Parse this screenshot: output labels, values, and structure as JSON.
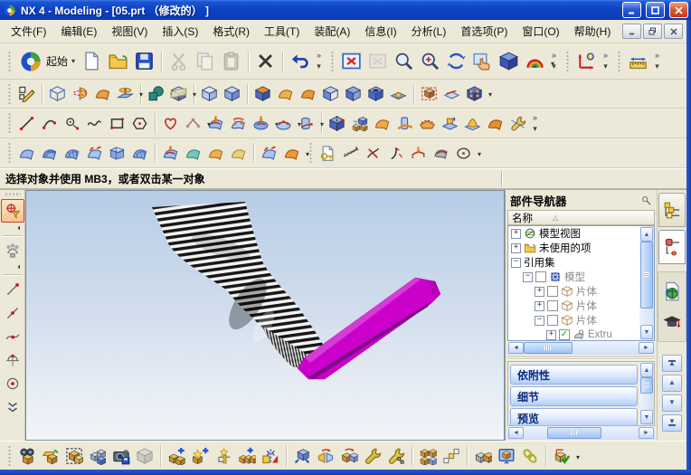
{
  "title": "NX 4 - Modeling - [05.prt （修改的） ]",
  "prompt": "选择对象并使用 MB3，或者双击某一对象",
  "menu_bar": {
    "items": [
      "文件(F)",
      "编辑(E)",
      "视图(V)",
      "插入(S)",
      "格式(R)",
      "工具(T)",
      "装配(A)",
      "信息(I)",
      "分析(L)",
      "首选项(P)",
      "窗口(O)",
      "帮助(H)"
    ]
  },
  "colors": {
    "titlebar_blue": "#0d43c4",
    "toolbar_bg": "#ece9d8",
    "viewport_top": "#b7cde6",
    "viewport_bottom": "#f2f5f9",
    "model_magenta": "#cb00ca",
    "section_text": "#0a2a7a"
  },
  "toolbars": {
    "start_label": "起始",
    "rowa": [
      {
        "n": "new-file-icon",
        "t": "page"
      },
      {
        "n": "open-file-icon",
        "t": "folder"
      },
      {
        "n": "save-icon",
        "t": "floppy"
      },
      {
        "n": "cut-icon",
        "t": "scissors",
        "f": "sD"
      },
      {
        "n": "copy-icon",
        "t": "pages",
        "f": "D"
      },
      {
        "n": "paste-icon",
        "t": "clip",
        "f": "D"
      },
      {
        "n": "delete-icon",
        "t": "xmark",
        "f": "s"
      },
      {
        "n": "undo-icon",
        "t": "undo",
        "f": "s"
      },
      {
        "n": "toolbar-overflow-icon",
        "t": "ovf"
      },
      {
        "n": "fit-view-icon",
        "t": "fitbox",
        "f": "b"
      },
      {
        "n": "zoom-window-icon",
        "t": "winrect",
        "f": "D"
      },
      {
        "n": "zoom-icon",
        "t": "mag"
      },
      {
        "n": "zoom-in-out-icon",
        "t": "magp"
      },
      {
        "n": "rotate-view-icon",
        "t": "rotate"
      },
      {
        "n": "pan-view-icon",
        "t": "hand"
      },
      {
        "n": "shaded-view-icon",
        "t": "cube",
        "c": [
          "#7b9be8",
          "#3a55c0",
          "#28409c"
        ]
      },
      {
        "n": "rendering-style-icon",
        "t": "rainbow",
        "f": "d"
      },
      {
        "n": "toolbar-overflow-icon",
        "t": "ovf"
      },
      {
        "n": "view-triad-icon",
        "t": "axes",
        "f": "b"
      },
      {
        "n": "toolbar-overflow-icon",
        "t": "ovf"
      },
      {
        "n": "measure-icon",
        "t": "ruler",
        "f": "b"
      },
      {
        "n": "toolbar-overflow-icon",
        "t": "ovf"
      }
    ],
    "rowb": [
      {
        "n": "sketch-icon",
        "t": "sketch"
      },
      {
        "n": "extrude-icon",
        "t": "wcube",
        "f": "s"
      },
      {
        "n": "revolve-icon",
        "t": "halfrev"
      },
      {
        "n": "swept-icon",
        "t": "sheet",
        "c": [
          "#e8a040",
          "#a05010"
        ]
      },
      {
        "n": "datum-plane-icon",
        "t": "datum",
        "f": "d"
      },
      {
        "n": "unite-boolean-icon",
        "t": "bool",
        "f": "sd"
      },
      {
        "n": "section-view-icon",
        "t": "scube",
        "f": "d"
      },
      {
        "n": "wireframe-display-icon",
        "t": "cube",
        "c": [
          "#dce8fa",
          "#b8ccf0",
          "#98b4e8"
        ],
        "f": "s"
      },
      {
        "n": "shaded-display-icon",
        "t": "cube",
        "c": [
          "#c0d4f8",
          "#8aaae8",
          "#6a8ad8"
        ]
      },
      {
        "n": "block-icon",
        "t": "cube",
        "c": [
          "#e88830",
          "#4a68c8",
          "#3450b0"
        ],
        "f": "s"
      },
      {
        "n": "flange-icon",
        "t": "sheet",
        "c": [
          "#f0b050",
          "#b06010"
        ]
      },
      {
        "n": "bend-icon",
        "t": "sheet",
        "c": [
          "#e89838",
          "#a05810"
        ]
      },
      {
        "n": "chamfer-icon",
        "t": "cube",
        "c": [
          "#b8ccf4",
          "#6888d8",
          "#e0e8f8"
        ]
      },
      {
        "n": "edge-blend-icon",
        "t": "cube",
        "c": [
          "#88a8e8",
          "#5070c8",
          "#88a0e0"
        ]
      },
      {
        "n": "hole-icon",
        "t": "hcube"
      },
      {
        "n": "boss-icon",
        "t": "boss"
      },
      {
        "n": "linked-body-icon",
        "t": "dashcube",
        "f": "s"
      },
      {
        "n": "split-body-icon",
        "t": "flatsheet"
      },
      {
        "n": "instance-feature-icon",
        "t": "dotcube",
        "f": "d"
      }
    ],
    "rowc": [
      {
        "n": "line-icon",
        "t": "line"
      },
      {
        "n": "arc-icon",
        "t": "arc"
      },
      {
        "n": "circle-icon",
        "t": "circ"
      },
      {
        "n": "spline-icon",
        "t": "spline"
      },
      {
        "n": "rectangle-icon",
        "t": "rect"
      },
      {
        "n": "polygon-icon",
        "t": "hex"
      },
      {
        "n": "studio-spline-icon",
        "t": "heart",
        "f": "s"
      },
      {
        "n": "point-set-icon",
        "t": "pset",
        "f": "d"
      },
      {
        "n": "project-curve-icon",
        "t": "proj"
      },
      {
        "n": "combined-projection-icon",
        "t": "proj2"
      },
      {
        "n": "join-curve-icon",
        "t": "pool",
        "f": "d"
      },
      {
        "n": "offset-curve-icon",
        "t": "pool2",
        "f": "d"
      },
      {
        "n": "intersection-curve-icon",
        "t": "cyl",
        "f": "d"
      },
      {
        "n": "mirror-body-icon",
        "t": "mirrcube",
        "f": "s"
      },
      {
        "n": "pattern-feature-icon",
        "t": "instgrid"
      },
      {
        "n": "thicken-icon",
        "t": "sheet",
        "c": [
          "#f0a848",
          "#a86018"
        ]
      },
      {
        "n": "wrap-geometry-icon",
        "t": "cylwrap"
      },
      {
        "n": "trim-body-icon",
        "t": "boat"
      },
      {
        "n": "pad-icon",
        "t": "steppad"
      },
      {
        "n": "emboss-icon",
        "t": "hill"
      },
      {
        "n": "sheet-flange-icon",
        "t": "sheet",
        "c": [
          "#e89030",
          "#985008"
        ]
      },
      {
        "n": "tweak-face-icon",
        "t": "wrencht"
      },
      {
        "n": "toolbar-overflow-icon",
        "t": "ovf"
      }
    ],
    "rowd": [
      {
        "n": "ruled-surface-icon",
        "t": "sheet",
        "c": [
          "#9ab8ec",
          "#4060a8"
        ]
      },
      {
        "n": "through-curves-icon",
        "t": "sheet3"
      },
      {
        "n": "through-curve-mesh-icon",
        "t": "sheetg"
      },
      {
        "n": "swept-surface-icon",
        "t": "sheetar"
      },
      {
        "n": "section-surface-icon",
        "t": "boxsheet"
      },
      {
        "n": "bounded-plane-icon",
        "t": "sheetg"
      },
      {
        "n": "n-sided-surface-icon",
        "t": "proj",
        "f": "s"
      },
      {
        "n": "law-extension-icon",
        "t": "sheet",
        "c": [
          "#78c8b8",
          "#2a8878"
        ]
      },
      {
        "n": "offset-surface-icon",
        "t": "sheet",
        "c": [
          "#f0b050",
          "#b06818"
        ]
      },
      {
        "n": "trimmed-sheet-icon",
        "t": "sheet",
        "c": [
          "#e8d080",
          "#a89030"
        ]
      },
      {
        "n": "extension-surface-icon",
        "t": "sheetar",
        "f": "s"
      },
      {
        "n": "flange-surface-icon",
        "t": "sheet",
        "c": [
          "#f09838",
          "#a05810"
        ],
        "f": "d"
      },
      {
        "n": "info-icon",
        "t": "key",
        "f": "b"
      },
      {
        "n": "deviation-check-icon",
        "t": "comb1"
      },
      {
        "n": "curve-analysis-icon",
        "t": "comb2"
      },
      {
        "n": "section-analysis-icon",
        "t": "comb3"
      },
      {
        "n": "reflection-analysis-icon",
        "t": "comb4"
      },
      {
        "n": "surface-analysis-icon",
        "t": "combs"
      },
      {
        "n": "draft-check-icon",
        "t": "cdot",
        "f": "d"
      }
    ],
    "rowe": [
      {
        "n": "find-component-icon",
        "t": "binoc"
      },
      {
        "n": "open-component-icon",
        "t": "opencube"
      },
      {
        "n": "select-component-icon",
        "t": "selcube"
      },
      {
        "n": "product-outline-icon",
        "t": "cubes3"
      },
      {
        "n": "snapshot-icon",
        "t": "cam"
      },
      {
        "n": "component-preview-icon",
        "t": "cube",
        "c": [
          "#c8c8c8",
          "#a8a8a8",
          "#989898"
        ],
        "f": "D"
      },
      {
        "n": "add-component-icon",
        "t": "cubeplus",
        "f": "s"
      },
      {
        "n": "new-component-icon",
        "t": "cubestar"
      },
      {
        "n": "create-parent-icon",
        "t": "startree"
      },
      {
        "n": "add-existing-component-icon",
        "t": "cubes2p"
      },
      {
        "n": "mirror-assembly-icon",
        "t": "tri"
      },
      {
        "n": "move-component-icon",
        "t": "movecube",
        "f": "s"
      },
      {
        "n": "replace-component-icon",
        "t": "replc"
      },
      {
        "n": "reposition-component-icon",
        "t": "repos"
      },
      {
        "n": "mate-component-icon",
        "t": "wrench"
      },
      {
        "n": "smart-constraint-icon",
        "t": "wrenchp"
      },
      {
        "n": "arrangements-icon",
        "t": "cubes4",
        "f": "s"
      },
      {
        "n": "sequence-icon",
        "t": "steps"
      },
      {
        "n": "wave-link-icon",
        "t": "wavec",
        "f": "s"
      },
      {
        "n": "interpart-link-icon",
        "t": "monitor"
      },
      {
        "n": "relations-icon",
        "t": "chain"
      },
      {
        "n": "assembly-check-icon",
        "t": "cubechk",
        "f": "sd"
      }
    ],
    "left": [
      {
        "n": "selection-filter-icon",
        "t": "filt",
        "f": "A"
      },
      {
        "n": "flyout-arrow-icon",
        "t": "flyl",
        "f": "y"
      },
      {
        "n": "snap-point-icon",
        "t": "snap",
        "f": "s"
      },
      {
        "n": "flyout-arrow-icon",
        "t": "flyl",
        "f": "y"
      },
      {
        "n": "end-point-icon",
        "t": "ep",
        "f": "s"
      },
      {
        "n": "mid-point-icon",
        "t": "mp"
      },
      {
        "n": "point-on-curve-icon",
        "t": "pc"
      },
      {
        "n": "quadrant-point-icon",
        "t": "qd"
      },
      {
        "n": "center-point-icon",
        "t": "ct"
      },
      {
        "n": "more-snaps-chevron-icon",
        "t": "chev"
      }
    ]
  },
  "part_navigator": {
    "title": "部件导航器",
    "column_header": "名称",
    "tree": [
      {
        "label": "模型视图",
        "expand": "+",
        "depth": 0,
        "icon": "mview",
        "checkbox": null,
        "dim": false
      },
      {
        "label": "未使用的项",
        "expand": "+",
        "depth": 0,
        "icon": "folder",
        "checkbox": null,
        "dim": false
      },
      {
        "label": "引用集",
        "expand": "-",
        "depth": 0,
        "icon": null,
        "checkbox": null,
        "dim": false
      },
      {
        "label": "模型",
        "expand": "-",
        "depth": 1,
        "icon": "mico",
        "checkbox": "unchecked",
        "dim": true
      },
      {
        "label": "片体",
        "expand": "+",
        "depth": 2,
        "icon": "shcube",
        "checkbox": "unchecked",
        "dim": true
      },
      {
        "label": "片体",
        "expand": "+",
        "depth": 2,
        "icon": "shcube",
        "checkbox": "unchecked",
        "dim": true
      },
      {
        "label": "片体",
        "expand": "-",
        "depth": 2,
        "icon": "shcube",
        "checkbox": "unchecked",
        "dim": true
      },
      {
        "label": "Extru",
        "expand": "+",
        "depth": 3,
        "icon": "ext",
        "checkbox": "checked",
        "dim": true
      }
    ],
    "sections": [
      "依附性",
      "细节",
      "预览"
    ]
  }
}
